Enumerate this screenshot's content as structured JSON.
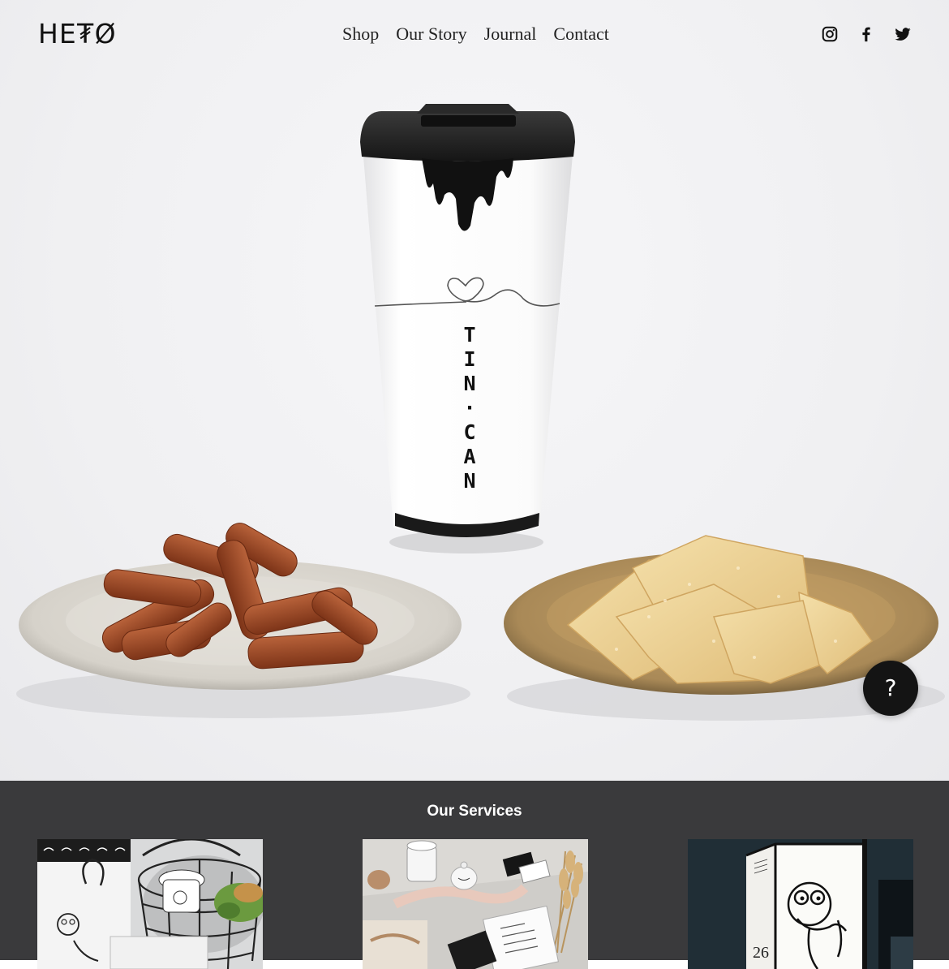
{
  "brand": {
    "logo_text": "HE₮Ø"
  },
  "nav": {
    "items": [
      {
        "label": "Shop"
      },
      {
        "label": "Our Story"
      },
      {
        "label": "Journal"
      },
      {
        "label": "Contact"
      }
    ]
  },
  "social": {
    "icons": [
      "instagram-icon",
      "facebook-icon",
      "twitter-icon"
    ]
  },
  "hero": {
    "cup_text": "TIN·CAN",
    "help_button": "?"
  },
  "services": {
    "title": "Our Services",
    "cards": [
      {
        "image": "gift-bag-tableware-photo"
      },
      {
        "image": "branding-flatlay-photo"
      },
      {
        "image": "lightbox-sign-photo",
        "number_on_sign": "26"
      }
    ]
  },
  "colors": {
    "services_bg": "#3a3a3c",
    "help_button_bg": "#141414",
    "text": "#222222"
  }
}
